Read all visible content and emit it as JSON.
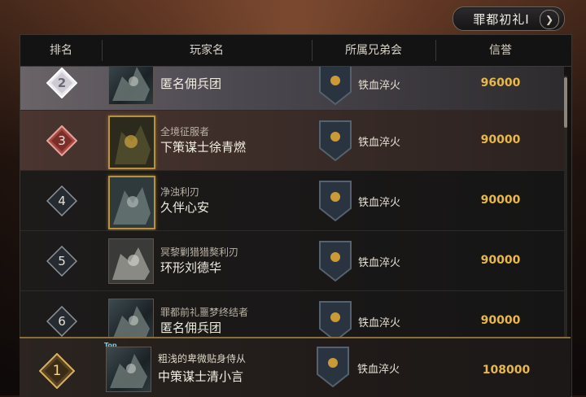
{
  "season_button": {
    "label": "罪都初礼Ⅰ",
    "icon": "chevron-right-icon"
  },
  "table": {
    "headers": {
      "rank": "排名",
      "player": "玩家名",
      "guild": "所属兄弟会",
      "prestige": "信誉"
    },
    "rows": [
      {
        "rank": "2",
        "title": "",
        "name": "匿名佣兵团",
        "guild": "铁血淬火",
        "score": "96000"
      },
      {
        "rank": "3",
        "title": "全境征服者",
        "name": "下策谋士徐青燃",
        "guild": "铁血淬火",
        "score": "90000"
      },
      {
        "rank": "4",
        "title": "净浊利刃",
        "name": "久伴心安",
        "guild": "铁血淬火",
        "score": "90000"
      },
      {
        "rank": "5",
        "title": "冥黎剿猎猎獒利刃",
        "name": "环形刘德华",
        "guild": "铁血淬火",
        "score": "90000"
      },
      {
        "rank": "6",
        "title": "罪都前礼噩梦终结者",
        "name": "匿名佣兵团",
        "guild": "铁血淬火",
        "score": "90000"
      }
    ]
  },
  "my_rank": {
    "rank": "1",
    "tag": "Top",
    "title": "粗浅的卑微贴身侍从",
    "name": "中策谋士清小言",
    "guild": "铁血淬火",
    "score": "108000"
  },
  "colors": {
    "score": "#e8b84a",
    "panel": "#121010",
    "highlight": "#4a3530"
  }
}
